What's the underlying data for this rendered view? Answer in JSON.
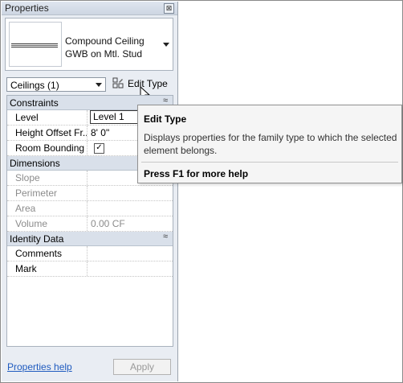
{
  "palette": {
    "title": "Properties",
    "close_glyph": "⊠",
    "type_selector": {
      "line1": "Compound Ceiling",
      "line2": "GWB on Mtl. Stud"
    },
    "instance_filter": "Ceilings (1)",
    "edit_type_label": "Edit Type",
    "groups": {
      "constraints": "Constraints",
      "dimensions": "Dimensions",
      "identity": "Identity Data",
      "collapse_glyph": "≈"
    },
    "rows": {
      "level": {
        "key": "Level",
        "value": "Level 1"
      },
      "height_offset": {
        "key": "Height Offset Fr...",
        "value": "8'  0\""
      },
      "room_bounding": {
        "key": "Room Bounding",
        "checked": "✓"
      },
      "slope": {
        "key": "Slope",
        "value": ""
      },
      "perimeter": {
        "key": "Perimeter",
        "value": ""
      },
      "area": {
        "key": "Area",
        "value": ""
      },
      "volume": {
        "key": "Volume",
        "value": "0.00 CF"
      },
      "comments": {
        "key": "Comments",
        "value": ""
      },
      "mark": {
        "key": "Mark",
        "value": ""
      }
    },
    "help_link": "Properties help",
    "apply_label": "Apply"
  },
  "tooltip": {
    "title": "Edit Type",
    "body": "Displays properties for the family type to which the selected element belongs.",
    "help": "Press F1 for more help"
  },
  "colors": {
    "link": "#1f5bbf",
    "group_header": "#d9e0ea",
    "panel_bg": "#e9edf3"
  }
}
